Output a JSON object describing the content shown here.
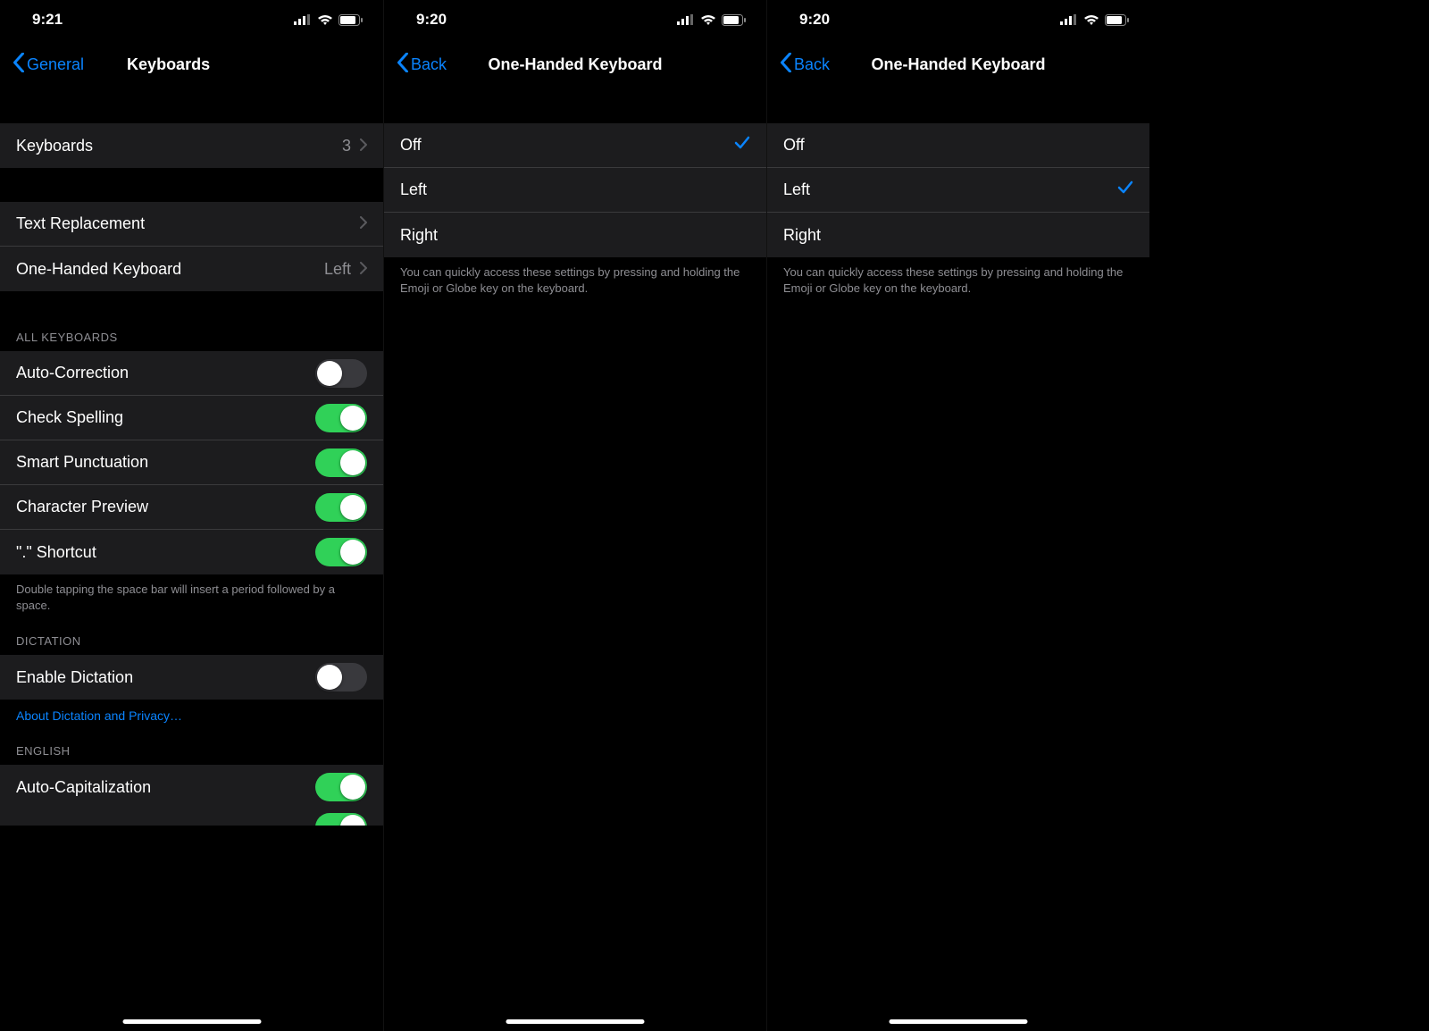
{
  "screens": [
    {
      "status": {
        "time": "9:21"
      },
      "nav": {
        "back": "General",
        "title": "Keyboards"
      },
      "rows": {
        "keyboards": {
          "label": "Keyboards",
          "value": "3"
        },
        "textReplacement": {
          "label": "Text Replacement"
        },
        "oneHanded": {
          "label": "One-Handed Keyboard",
          "value": "Left"
        }
      },
      "sections": {
        "allKeyboards": {
          "header": "ALL KEYBOARDS",
          "items": [
            {
              "label": "Auto-Correction",
              "on": false
            },
            {
              "label": "Check Spelling",
              "on": true
            },
            {
              "label": "Smart Punctuation",
              "on": true
            },
            {
              "label": "Character Preview",
              "on": true
            },
            {
              "label": "\".\" Shortcut",
              "on": true
            }
          ],
          "footer": "Double tapping the space bar will insert a period followed by a space."
        },
        "dictation": {
          "header": "DICTATION",
          "items": [
            {
              "label": "Enable Dictation",
              "on": false
            }
          ],
          "link": "About Dictation and Privacy…"
        },
        "english": {
          "header": "ENGLISH",
          "items": [
            {
              "label": "Auto-Capitalization",
              "on": true
            }
          ]
        }
      }
    },
    {
      "status": {
        "time": "9:20"
      },
      "nav": {
        "back": "Back",
        "title": "One-Handed Keyboard"
      },
      "options": [
        {
          "label": "Off",
          "selected": true
        },
        {
          "label": "Left",
          "selected": false
        },
        {
          "label": "Right",
          "selected": false
        }
      ],
      "footer": "You can quickly access these settings by pressing and holding the Emoji or Globe key on the keyboard."
    },
    {
      "status": {
        "time": "9:20"
      },
      "nav": {
        "back": "Back",
        "title": "One-Handed Keyboard"
      },
      "options": [
        {
          "label": "Off",
          "selected": false
        },
        {
          "label": "Left",
          "selected": true
        },
        {
          "label": "Right",
          "selected": false
        }
      ],
      "footer": "You can quickly access these settings by pressing and holding the Emoji or Globe key on the keyboard."
    }
  ]
}
